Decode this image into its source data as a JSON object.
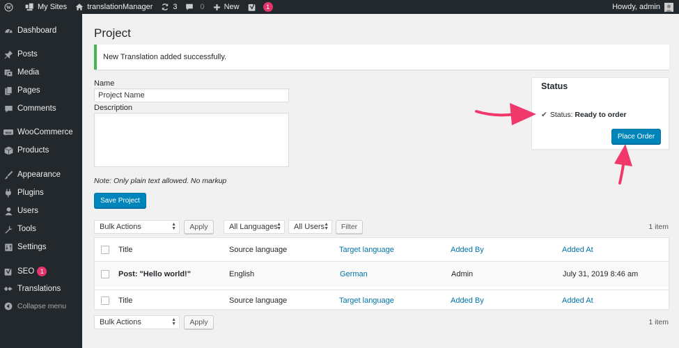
{
  "admin_bar": {
    "my_sites": "My Sites",
    "site_name": "translationManager",
    "updates_count": "3",
    "comments_count": "0",
    "new_label": "New",
    "yoast_count": "1",
    "greeting": "Howdy, admin"
  },
  "sidebar": {
    "items": [
      {
        "label": "Dashboard",
        "icon": "dashboard-icon"
      },
      {
        "label": "Posts",
        "icon": "pin-icon"
      },
      {
        "label": "Media",
        "icon": "media-icon"
      },
      {
        "label": "Pages",
        "icon": "pages-icon"
      },
      {
        "label": "Comments",
        "icon": "comments-icon"
      },
      {
        "label": "WooCommerce",
        "icon": "woocommerce-icon"
      },
      {
        "label": "Products",
        "icon": "products-icon"
      },
      {
        "label": "Appearance",
        "icon": "appearance-icon"
      },
      {
        "label": "Plugins",
        "icon": "plugins-icon"
      },
      {
        "label": "Users",
        "icon": "users-icon"
      },
      {
        "label": "Tools",
        "icon": "tools-icon"
      },
      {
        "label": "Settings",
        "icon": "settings-icon"
      },
      {
        "label": "SEO",
        "icon": "yoast-icon",
        "badge": "1"
      },
      {
        "label": "Translations",
        "icon": "translations-icon"
      }
    ],
    "collapse_label": "Collapse menu"
  },
  "page": {
    "title": "Project",
    "notice": "New Translation added successfully.",
    "name_label": "Name",
    "name_value": "Project Name",
    "description_label": "Description",
    "description_value": "",
    "note": "Note: Only plain text allowed. No markup",
    "save_button": "Save Project"
  },
  "status_box": {
    "title": "Status",
    "status_prefix": "Status:",
    "status_value": "Ready to order",
    "place_order_button": "Place Order"
  },
  "filters": {
    "bulk_actions": "Bulk Actions",
    "apply": "Apply",
    "all_languages": "All Languages",
    "all_users": "All Users",
    "filter": "Filter",
    "items_count": "1 item"
  },
  "table": {
    "columns": [
      "Title",
      "Source language",
      "Target language",
      "Added By",
      "Added At"
    ],
    "rows": [
      {
        "title": "Post: \"Hello world!\"",
        "source": "English",
        "target": "German",
        "added_by": "Admin",
        "added_at": "July 31, 2019 8:46 am"
      }
    ]
  },
  "colors": {
    "primary": "#0085ba",
    "admin_bar": "#23282d",
    "annotation_arrow": "#f0386b"
  }
}
